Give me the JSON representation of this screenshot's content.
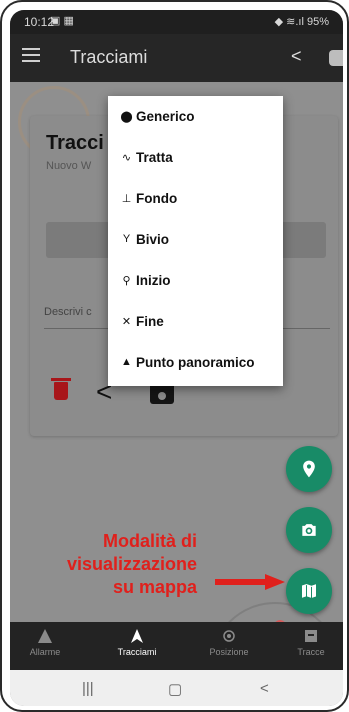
{
  "statusbar": {
    "time": "10:12",
    "right": "◆ ≋.ıl 95%"
  },
  "appbar": {
    "title": "Tracciami"
  },
  "card": {
    "title": "Tracci",
    "subtitle": "Nuovo W",
    "description_label": "Descrivi c"
  },
  "dropdown": {
    "items": [
      {
        "label": "Generico",
        "icon": "location-pin-icon"
      },
      {
        "label": "Tratta",
        "icon": "route-icon"
      },
      {
        "label": "Fondo",
        "icon": "ground-icon"
      },
      {
        "label": "Bivio",
        "icon": "fork-icon"
      },
      {
        "label": "Inizio",
        "icon": "start-pin-icon"
      },
      {
        "label": "Fine",
        "icon": "end-icon"
      },
      {
        "label": "Punto panoramico",
        "icon": "panorama-icon"
      }
    ]
  },
  "annotation": {
    "line1": "Modalità di",
    "line2": "visualizzazione",
    "line3": "su mappa"
  },
  "bottomnav": {
    "items": [
      {
        "label": "Allarme"
      },
      {
        "label": "Tracciami"
      },
      {
        "label": "Posizione"
      },
      {
        "label": "Tracce"
      }
    ]
  },
  "colors": {
    "accent": "#188b67",
    "annotation": "#e0201c",
    "delete": "#a8161a"
  }
}
